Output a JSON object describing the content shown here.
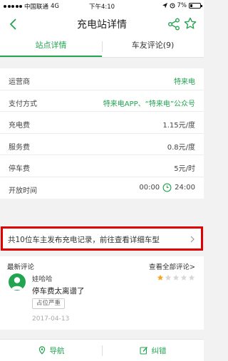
{
  "status_bar": {
    "carrier": "中国联通",
    "network": "4G",
    "time": "下午4:10",
    "battery": "7%"
  },
  "header": {
    "title": "充电站详情",
    "icons": [
      "back-arrow-icon",
      "share-icon",
      "star-outline-icon"
    ]
  },
  "tabs": [
    {
      "label": "站点详情",
      "active": true
    },
    {
      "label": "车友评论(9)",
      "active": false
    }
  ],
  "info": {
    "operator": {
      "key": "运营商",
      "value": "特来电"
    },
    "payment": {
      "key": "支付方式",
      "value": "特来电APP、“特来电”公众号"
    },
    "charge_fee": {
      "key": "充电费",
      "value": "1.15元/度"
    },
    "service_fee": {
      "key": "服务费",
      "value": "0.8元/度"
    },
    "parking_fee": {
      "key": "停车费",
      "value": "5元/时"
    },
    "hours": {
      "key": "开放时间",
      "open": "00:00",
      "close": "24:00"
    }
  },
  "notice": {
    "text": "共10位车主发布充电记录，前往查看详细车型"
  },
  "reviews": {
    "heading": "最新评论",
    "view_all": "查看全部评论>",
    "latest": {
      "user": "娃哈哈",
      "rating": 1,
      "max_rating": 5,
      "text": "停车费太离谱了",
      "tag": "占位严重",
      "date": "2017-04-13"
    }
  },
  "bottom_bar": {
    "navigate": "导航",
    "correct": "纠错"
  },
  "colors": {
    "accent": "#23a450",
    "highlight_border": "#e00000",
    "star_filled": "#f5a623",
    "star_empty": "#d8d8d8"
  }
}
